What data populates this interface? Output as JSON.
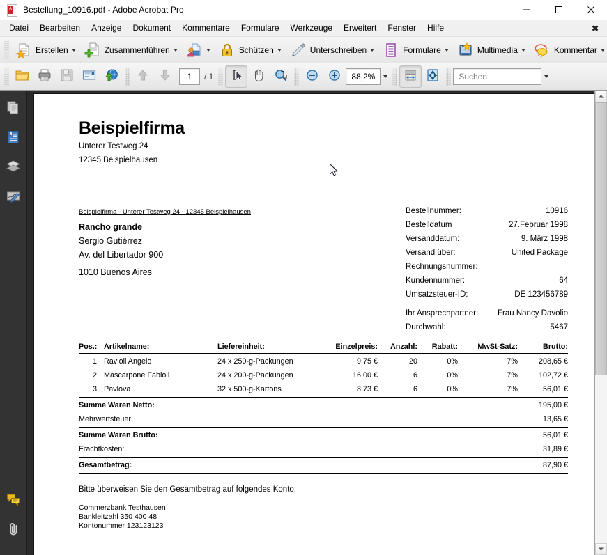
{
  "window": {
    "title": "Bestellung_10916.pdf - Adobe Acrobat Pro",
    "app_icon": "pdf-document-icon",
    "minimize": "–",
    "maximize": "□",
    "close": "✕"
  },
  "menubar": {
    "items": [
      {
        "label": "Datei",
        "name": "menu-datei"
      },
      {
        "label": "Bearbeiten",
        "name": "menu-bearbeiten"
      },
      {
        "label": "Anzeige",
        "name": "menu-anzeige"
      },
      {
        "label": "Dokument",
        "name": "menu-dokument"
      },
      {
        "label": "Kommentare",
        "name": "menu-kommentare"
      },
      {
        "label": "Formulare",
        "name": "menu-formulare"
      },
      {
        "label": "Werkzeuge",
        "name": "menu-werkzeuge"
      },
      {
        "label": "Erweitert",
        "name": "menu-erweitert"
      },
      {
        "label": "Fenster",
        "name": "menu-fenster"
      },
      {
        "label": "Hilfe",
        "name": "menu-hilfe"
      }
    ],
    "close_glyph": "✖"
  },
  "toolbar_main": {
    "buttons": [
      {
        "label": "Erstellen",
        "icon": "create-pdf-icon",
        "dropdown": true
      },
      {
        "label": "Zusammenführen",
        "icon": "merge-files-icon",
        "dropdown": true
      },
      {
        "label": "",
        "icon": "collaborate-icon",
        "dropdown": true
      },
      {
        "label": "Schützen",
        "icon": "lock-icon",
        "dropdown": true
      },
      {
        "label": "Unterschreiben",
        "icon": "pen-sign-icon",
        "dropdown": true
      },
      {
        "label": "Formulare",
        "icon": "forms-icon",
        "dropdown": true
      },
      {
        "label": "Multimedia",
        "icon": "multimedia-icon",
        "dropdown": true
      },
      {
        "label": "Kommentar",
        "icon": "comment-bubble-icon",
        "dropdown": true
      }
    ]
  },
  "toolbar_secondary": {
    "open_icon": "open-folder-icon",
    "print_icon": "print-icon",
    "save_icon": "save-disk-icon",
    "email_icon": "email-icon",
    "upload_icon": "upload-globe-icon",
    "prev_page_icon": "arrow-up-icon",
    "next_page_icon": "arrow-down-icon",
    "page_current": "1",
    "page_separator": "/ 1",
    "select_tool_icon": "select-text-icon",
    "hand_tool_icon": "hand-icon",
    "marquee_zoom_icon": "marquee-zoom-icon",
    "zoom_out_icon": "zoom-out-icon",
    "zoom_in_icon": "zoom-in-icon",
    "zoom_value": "88,2%",
    "fit_width_icon": "fit-width-icon",
    "fit_page_icon": "fit-page-icon",
    "search_placeholder": "Suchen"
  },
  "navigation_panel": {
    "items": [
      {
        "name": "page-thumbnails-icon",
        "tooltip": "Seitenminiaturen"
      },
      {
        "name": "bookmarks-icon",
        "tooltip": "Lesezeichen"
      },
      {
        "name": "layers-icon",
        "tooltip": "Ebenen"
      },
      {
        "name": "signatures-icon",
        "tooltip": "Unterschriften"
      }
    ],
    "bottom_items": [
      {
        "name": "comments-icon",
        "tooltip": "Kommentare"
      },
      {
        "name": "attachments-paperclip-icon",
        "tooltip": "Anlagen"
      }
    ]
  },
  "document": {
    "company": {
      "name": "Beispielfirma",
      "street": "Unterer Testweg 24",
      "city": "12345 Beispielhausen"
    },
    "sender_line": "Beispielfirma - Unterer Testweg 24 - 12345 Beispielhausen",
    "recipient": {
      "company": "Rancho grande",
      "contact": "Sergio Gutiérrez",
      "street": "Av. del Libertador 900",
      "city": "1010 Buenos Aires"
    },
    "info": [
      {
        "label": "Bestellnummer:",
        "value": "10916"
      },
      {
        "label": "Bestelldatum",
        "value": "27.Februar 1998"
      },
      {
        "label": "Versanddatum:",
        "value": "9. März 1998"
      },
      {
        "label": "Versand über:",
        "value": "United Package"
      },
      {
        "label": "Rechnungsnummer:",
        "value": ""
      },
      {
        "label": "Kundennummer:",
        "value": "64"
      },
      {
        "label": "Umsatzsteuer-ID:",
        "value": "DE 123456789"
      }
    ],
    "contact_info": [
      {
        "label": "Ihr Ansprechpartner:",
        "value": "Frau Nancy Davolio"
      },
      {
        "label": "Durchwahl:",
        "value": "5467"
      }
    ],
    "table": {
      "headers": [
        "Pos.:",
        "Artikelname:",
        "Liefereinheit:",
        "Einzelpreis:",
        "Anzahl:",
        "Rabatt:",
        "MwSt-Satz:",
        "Brutto:"
      ],
      "rows": [
        {
          "pos": "1",
          "name": "Ravioli Angelo",
          "unit": "24 x 250-g-Packungen",
          "price": "9,75 €",
          "qty": "20",
          "discount": "0%",
          "vat": "7%",
          "gross": "208,65 €"
        },
        {
          "pos": "2",
          "name": "Mascarpone Fabioli",
          "unit": "24 x 200-g-Packungen",
          "price": "16,00 €",
          "qty": "6",
          "discount": "0%",
          "vat": "7%",
          "gross": "102,72 €"
        },
        {
          "pos": "3",
          "name": "Pavlova",
          "unit": "32 x 500-g-Kartons",
          "price": "8,73 €",
          "qty": "6",
          "discount": "0%",
          "vat": "7%",
          "gross": "56,01 €"
        }
      ]
    },
    "totals": [
      {
        "label": "Summe Waren Netto:",
        "value": "195,00 €",
        "bold": true
      },
      {
        "label": "Mehrwertsteuer:",
        "value": "13,65 €",
        "bold": false
      },
      {
        "label": "Summe Waren Brutto:",
        "value": "56,01 €",
        "bold": true
      },
      {
        "label": "Frachtkosten:",
        "value": "31,89 €",
        "bold": false
      },
      {
        "label": "Gesamtbetrag:",
        "value": "87,90 €",
        "bold": true
      }
    ],
    "footer": {
      "instruction": "Bitte überweisen Sie den Gesamtbetrag auf folgendes Konto:",
      "bank": "Commerzbank Testhausen",
      "blz": "Bankleitzahl 350 400 48",
      "account": "Kontonummer 123123123"
    }
  },
  "colors": {
    "titlebar_bg": "#ffffff",
    "menu_bg": "#f0f0f0",
    "toolbar_bg": "#eeeeee",
    "nav_panel_bg": "#333333",
    "doc_backdrop": "#2b2b2b",
    "page_bg": "#ffffff"
  }
}
